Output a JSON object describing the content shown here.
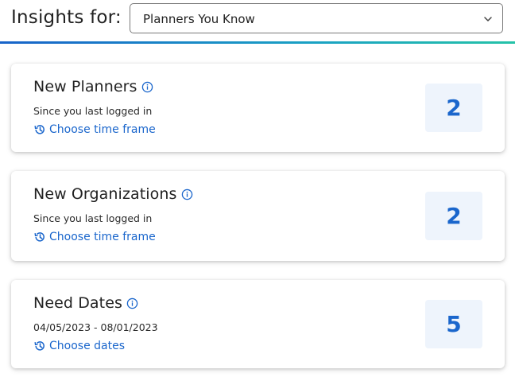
{
  "header": {
    "title": "Insights for:",
    "select_value": "Planners You Know"
  },
  "cards": [
    {
      "title": "New Planners",
      "subtitle": "Since you last logged in",
      "link": "Choose time frame",
      "count": "2"
    },
    {
      "title": "New Organizations",
      "subtitle": "Since you last logged in",
      "link": "Choose time frame",
      "count": "2"
    },
    {
      "title": "Need Dates",
      "subtitle": "04/05/2023 - 08/01/2023",
      "link": "Choose dates",
      "count": "5"
    }
  ],
  "icons": {
    "info": "info-icon",
    "history": "history-icon",
    "chevron": "chevron-down-icon"
  },
  "colors": {
    "accent": "#1a66cc",
    "count_bg": "#eef4fc",
    "gradient_start": "#1763c9",
    "gradient_end": "#25c2a8"
  }
}
